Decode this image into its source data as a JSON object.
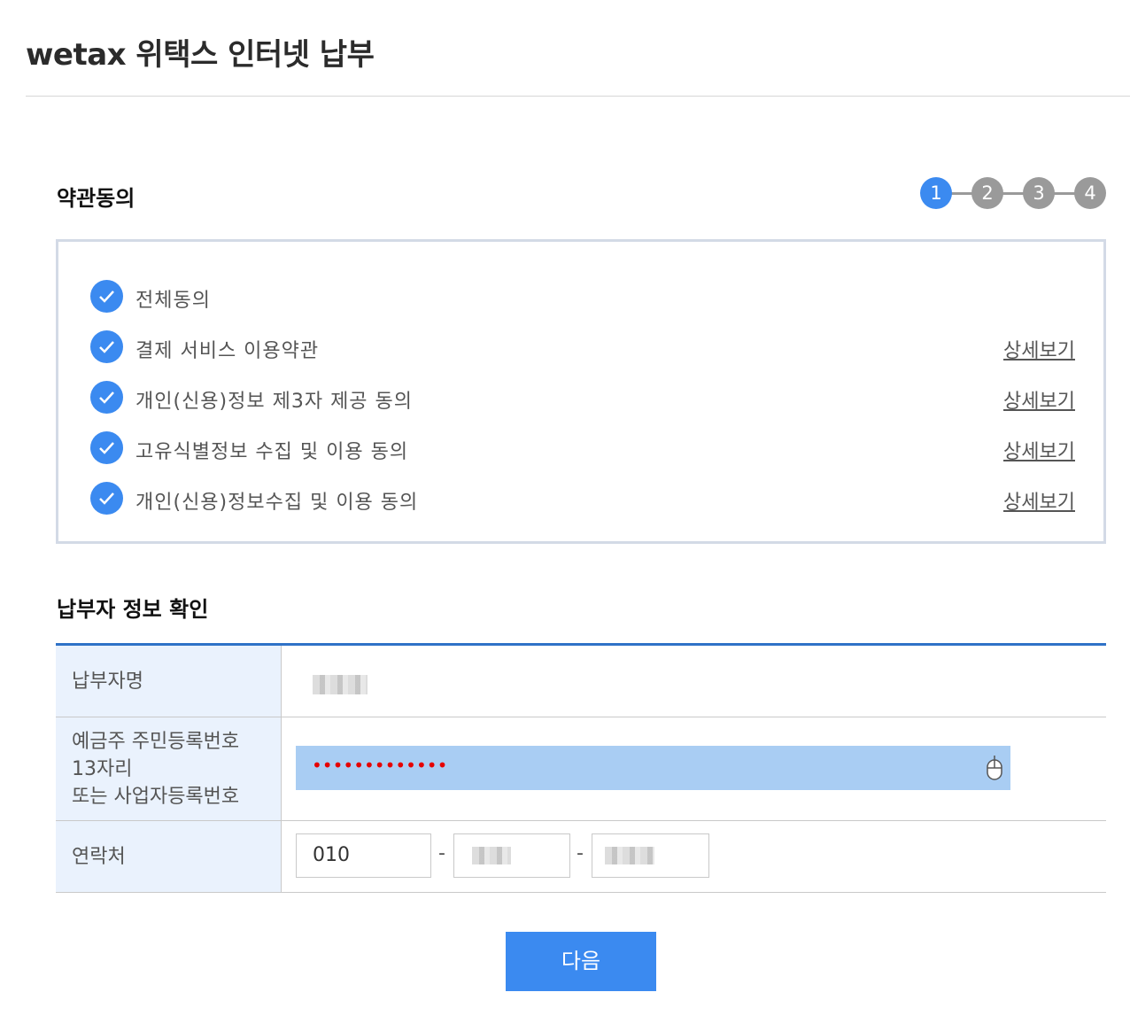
{
  "header": {
    "title": "wetax 위택스 인터넷 납부"
  },
  "terms": {
    "title": "약관동의",
    "steps": [
      "1",
      "2",
      "3",
      "4"
    ],
    "active_step": 1,
    "items": [
      {
        "label": "전체동의",
        "detail": ""
      },
      {
        "label": "결제 서비스 이용약관",
        "detail": "상세보기"
      },
      {
        "label": "개인(신용)정보 제3자 제공 동의",
        "detail": "상세보기"
      },
      {
        "label": "고유식별정보 수집 및 이용 동의",
        "detail": "상세보기"
      },
      {
        "label": "개인(신용)정보수집 및 이용 동의",
        "detail": "상세보기"
      }
    ]
  },
  "payer": {
    "title": "납부자 정보 확인",
    "name_label": "납부자명",
    "id_label_1": "예금주 주민등록번호",
    "id_label_2": "13자리",
    "id_label_3": "또는 사업자등록번호",
    "id_masked": "•••••••••••••",
    "phone_label": "연락처",
    "phone_first": "010",
    "dash": "-"
  },
  "actions": {
    "next_label": "다음"
  },
  "colors": {
    "accent": "#3b8af0",
    "inactive_step": "#9a9a9a",
    "table_border": "#2f72c7",
    "input_highlight": "#a9cdf3"
  }
}
